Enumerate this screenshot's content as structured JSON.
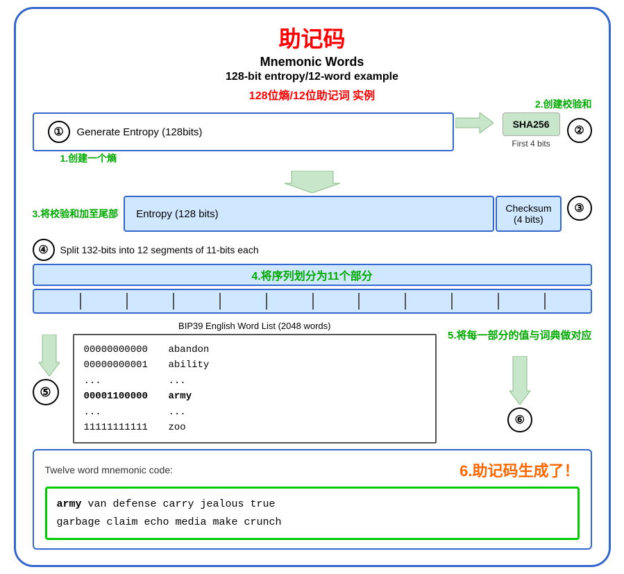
{
  "title": {
    "zh": "助记码",
    "en1": "Mnemonic Words",
    "en2": "128-bit entropy/12-word example",
    "zh_sub": "128位熵/12位助记词 实例"
  },
  "annotations": {
    "step1": "1.创建一个熵",
    "step2": "2.创建校验和",
    "step3": "3.将校验和加至尾部",
    "step4": "4.将序列划分为11个部分",
    "step5": "5.将每一部分的值与词典做对应",
    "step6": "6.助记码生成了！"
  },
  "step1": {
    "circle": "①",
    "label": "Generate Entropy (128bits)"
  },
  "step2": {
    "sha_label": "SHA256",
    "sha_sub": "First 4 bits",
    "circle": "②"
  },
  "step3": {
    "entropy_label": "Entropy (128 bits)",
    "checksum_label": "Checksum\n(4 bits)",
    "circle": "③"
  },
  "step4": {
    "circle": "④",
    "desc": "Split 132-bits into 12 segments of 11-bits each",
    "zh_label": "4.将序列划分为11个部分",
    "segments_count": 12
  },
  "step5": {
    "circle": "⑤",
    "bip39_title": "BIP39 English Word List (2048 words)",
    "rows": [
      {
        "bits": "00000000000",
        "word": "abandon"
      },
      {
        "bits": "00000000001",
        "word": "ability"
      },
      {
        "bits": "...",
        "word": "..."
      },
      {
        "bits": "00001100000",
        "word": "army",
        "bold": true
      },
      {
        "bits": "...",
        "word": "..."
      },
      {
        "bits": "11111111111",
        "word": "zoo"
      }
    ]
  },
  "step6": {
    "circle": "⑥",
    "label_zh": "6.助记码生成了！",
    "twelve_word_label": "Twelve word mnemonic code:",
    "mnemonic_first": "army",
    "mnemonic_rest": " van defense carry jealous true\ngarbage claim echo media make crunch"
  }
}
